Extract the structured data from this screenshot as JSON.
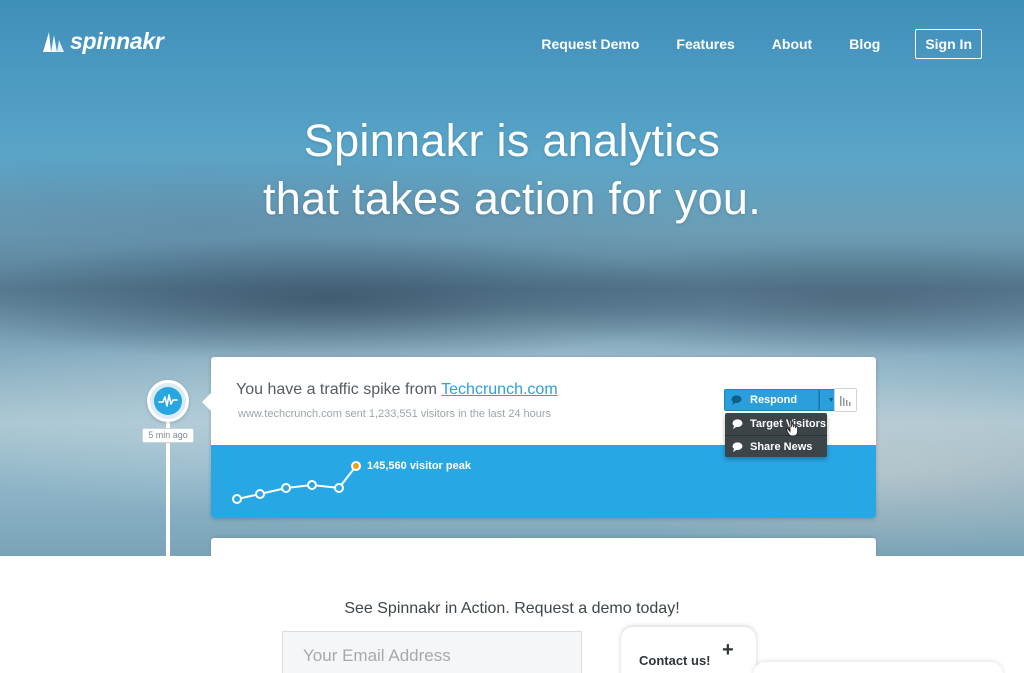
{
  "header": {
    "logo_text": "spinnakr",
    "nav": [
      {
        "label": "Request Demo"
      },
      {
        "label": "Features"
      },
      {
        "label": "About"
      },
      {
        "label": "Blog"
      }
    ],
    "signin_label": "Sign In"
  },
  "hero": {
    "headline_line1": "Spinnakr is analytics",
    "headline_line2": "that takes action for you."
  },
  "timeline": {
    "time_label": "5 min ago"
  },
  "alert_card": {
    "title_prefix": "You have a traffic spike from ",
    "title_link": "Techcrunch.com",
    "subtitle": "www.techcrunch.com sent 1,233,551 visitors in the last 24 hours",
    "peak_label": "145,560 visitor peak",
    "respond_label": "Respond",
    "dropdown_items": [
      {
        "label": "Target Visitors",
        "icon": "speech-bubble-icon"
      },
      {
        "label": "Share News",
        "icon": "speech-bubble-icon"
      }
    ]
  },
  "cta": {
    "text": "See Spinnakr in Action. Request a demo today!",
    "email_placeholder": "Your Email Address"
  },
  "contact": {
    "label": "Contact us!",
    "plus": "+"
  },
  "colors": {
    "accent_blue": "#27a7e3",
    "dropdown_bg": "#3d4448",
    "peak_dot": "#f39c12"
  }
}
